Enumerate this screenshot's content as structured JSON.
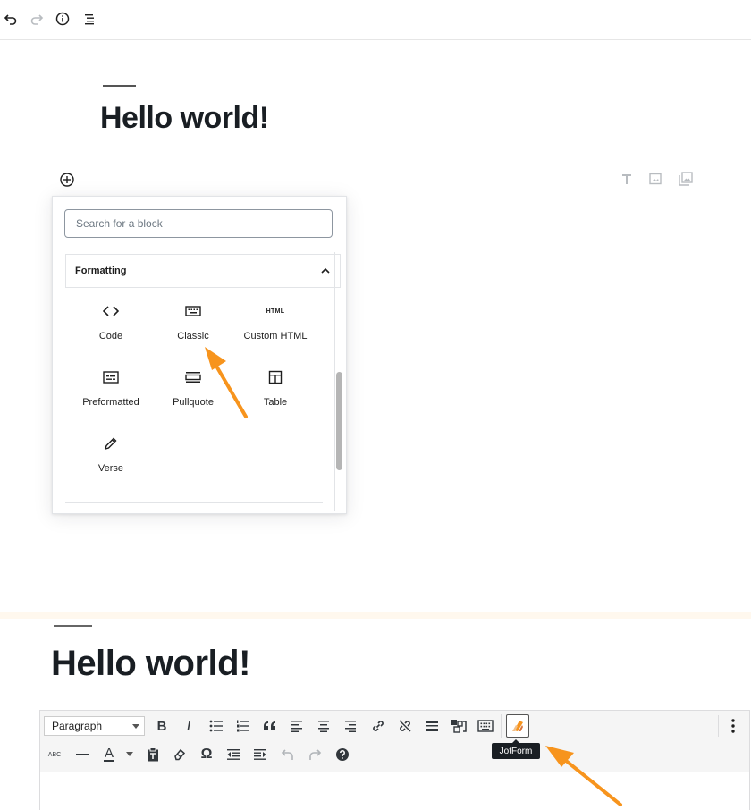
{
  "top_toolbar": {
    "icons": [
      "undo-icon",
      "redo-icon",
      "info-icon",
      "list-view-icon"
    ]
  },
  "editor": {
    "post_title": "Hello world!",
    "right_icons": [
      "text-icon",
      "image-icon",
      "gallery-icon"
    ]
  },
  "inserter": {
    "search_placeholder": "Search for a block",
    "panel_title": "Formatting",
    "blocks": [
      {
        "label": "Code",
        "icon": "code-icon"
      },
      {
        "label": "Classic",
        "icon": "keyboard-icon"
      },
      {
        "label": "Custom HTML",
        "icon": "html-icon"
      },
      {
        "label": "Preformatted",
        "icon": "preformatted-icon"
      },
      {
        "label": "Pullquote",
        "icon": "pullquote-icon"
      },
      {
        "label": "Table",
        "icon": "table-icon"
      },
      {
        "label": "Verse",
        "icon": "pencil-icon"
      }
    ],
    "html_icon_text": "HTML"
  },
  "classic_editor": {
    "post_title": "Hello world!",
    "format_select": "Paragraph",
    "row1_icons": [
      "bold-icon",
      "italic-icon",
      "bulleted-list-icon",
      "numbered-list-icon",
      "blockquote-icon",
      "align-left-icon",
      "align-center-icon",
      "align-right-icon",
      "link-icon",
      "unlink-icon",
      "read-more-icon",
      "fullscreen-icon",
      "toolbar-toggle-icon",
      "jotform-icon"
    ],
    "row2_icons": [
      "strikethrough-icon",
      "horizontal-line-icon",
      "text-color-icon",
      "paste-text-icon",
      "clear-formatting-icon",
      "special-character-icon",
      "outdent-icon",
      "indent-icon",
      "undo-icon",
      "redo-icon",
      "help-icon"
    ],
    "tooltip": "JotForm",
    "bold_glyph": "B",
    "italic_glyph": "I",
    "text_color_glyph": "A",
    "omega_glyph": "Ω",
    "strike_glyph": "ABC"
  },
  "colors": {
    "accent_arrow": "#f7941d",
    "band": "#fff8ee"
  }
}
